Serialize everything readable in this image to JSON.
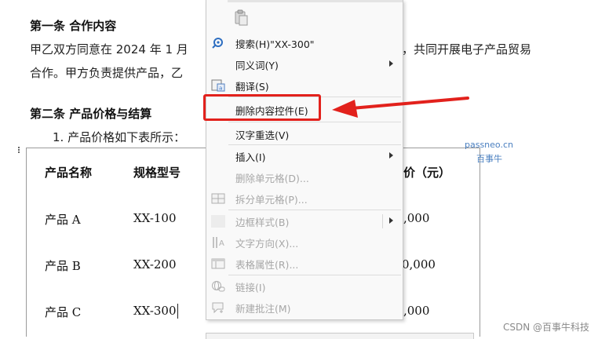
{
  "document": {
    "article1_title": "第一条  合作内容",
    "article1_line1_left": "甲乙双方同意在 2024 年 1 月",
    "article1_line1_right": "，共同开展电子产品贸易",
    "article1_line2_left": "合作。甲方负责提供产品，乙",
    "article2_title": "第二条  产品价格与结算",
    "list_item": "1.  产品价格如下表所示："
  },
  "table": {
    "headers": [
      "产品名称",
      "规格型号",
      "价（元）"
    ],
    "rows": [
      {
        "name": "产品 A",
        "model": "XX-100",
        "price": ",000"
      },
      {
        "name": "产品 B",
        "model": "XX-200",
        "price": "0,000"
      },
      {
        "name": "产品 C",
        "model": "XX-300",
        "price": ",000"
      }
    ]
  },
  "context_menu": {
    "items": [
      {
        "label": "搜索(H)\"XX-300\"",
        "disabled": false
      },
      {
        "label": "同义词(Y)",
        "disabled": false
      },
      {
        "label": "翻译(S)",
        "disabled": false
      },
      {
        "label": "删除内容控件(E)",
        "disabled": false
      },
      {
        "label": "汉字重选(V)",
        "disabled": false
      },
      {
        "label": "插入(I)",
        "disabled": false
      },
      {
        "label": "删除单元格(D)...",
        "disabled": true
      },
      {
        "label": "拆分单元格(P)...",
        "disabled": true
      },
      {
        "label": "边框样式(B)",
        "disabled": true
      },
      {
        "label": "文字方向(X)...",
        "disabled": true
      },
      {
        "label": "表格属性(R)...",
        "disabled": true
      },
      {
        "label": "链接(I)",
        "disabled": true
      },
      {
        "label": "新建批注(M)",
        "disabled": true
      }
    ]
  },
  "watermark": {
    "line1": "passneo.cn",
    "line2": "百事牛",
    "footer": "CSDN @百事牛科技"
  },
  "colors": {
    "highlight": "#e2211c",
    "watermark": "#4a7fc0"
  }
}
